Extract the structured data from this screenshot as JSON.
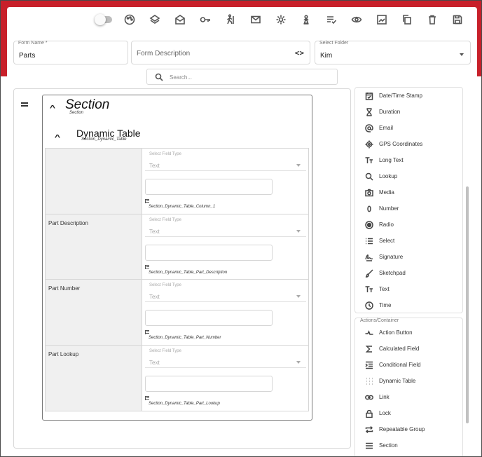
{
  "toolbar": {
    "buttons": [
      "toggle-icon",
      "palette-icon",
      "layers-icon",
      "mail-open-icon",
      "key-icon",
      "person-walk-icon",
      "mail-icon",
      "gear-icon",
      "chess-pawn-icon",
      "list-check-icon",
      "eye-icon",
      "image-icon",
      "copy-icon",
      "trash-icon",
      "save-icon"
    ]
  },
  "form": {
    "name_label": "Form Name *",
    "name_value": "Parts",
    "description_placeholder": "Form Description",
    "description_icon": "code-icon",
    "folder_label": "Select Folder",
    "folder_value": "Kim"
  },
  "search": {
    "placeholder": "Search..."
  },
  "section": {
    "title": "Section",
    "subtitle": "Section",
    "dynamic_table": {
      "title": "Dynamic Table",
      "subtitle": "Section_Dynamic_Table",
      "rows": [
        {
          "label": "",
          "select_label": "Select Field Type",
          "select_value": "Text",
          "field_name": "Section_Dynamic_Table_Column_1"
        },
        {
          "label": "Part Description",
          "select_label": "Select Field Type",
          "select_value": "Text",
          "field_name": "Section_Dynamic_Table_Part_Description"
        },
        {
          "label": "Part Number",
          "select_label": "Select Field Type",
          "select_value": "Text",
          "field_name": "Section_Dynamic_Table_Part_Number"
        },
        {
          "label": "Part Lookup",
          "select_label": "Select Field Type",
          "select_value": "Text",
          "field_name": "Section_Dynamic_Table_Part_Lookup"
        }
      ]
    }
  },
  "field_types": {
    "items": [
      {
        "label": "Date/Time Stamp",
        "icon": "calendar-check-icon"
      },
      {
        "label": "Duration",
        "icon": "hourglass-icon"
      },
      {
        "label": "Email",
        "icon": "at-icon"
      },
      {
        "label": "GPS Coordinates",
        "icon": "gps-icon"
      },
      {
        "label": "Long Text",
        "icon": "text-size-icon"
      },
      {
        "label": "Lookup",
        "icon": "search-icon"
      },
      {
        "label": "Media",
        "icon": "camera-icon"
      },
      {
        "label": "Number",
        "icon": "zero-icon"
      },
      {
        "label": "Radio",
        "icon": "radio-icon"
      },
      {
        "label": "Select",
        "icon": "list-icon"
      },
      {
        "label": "Signature",
        "icon": "signature-icon"
      },
      {
        "label": "Sketchpad",
        "icon": "brush-icon"
      },
      {
        "label": "Text",
        "icon": "text-size-icon"
      },
      {
        "label": "Time",
        "icon": "clock-icon"
      }
    ]
  },
  "actions": {
    "header": "Actions/Container",
    "items": [
      {
        "label": "Action Button",
        "icon": "action-icon"
      },
      {
        "label": "Calculated Field",
        "icon": "sigma-icon"
      },
      {
        "label": "Conditional Field",
        "icon": "conditional-icon"
      },
      {
        "label": "Dynamic Table",
        "icon": "grid-dots-icon"
      },
      {
        "label": "Link",
        "icon": "link-icon"
      },
      {
        "label": "Lock",
        "icon": "lock-icon"
      },
      {
        "label": "Repeatable Group",
        "icon": "repeat-icon"
      },
      {
        "label": "Section",
        "icon": "section-icon"
      }
    ]
  },
  "colors": {
    "brand_red": "#c8202a"
  }
}
